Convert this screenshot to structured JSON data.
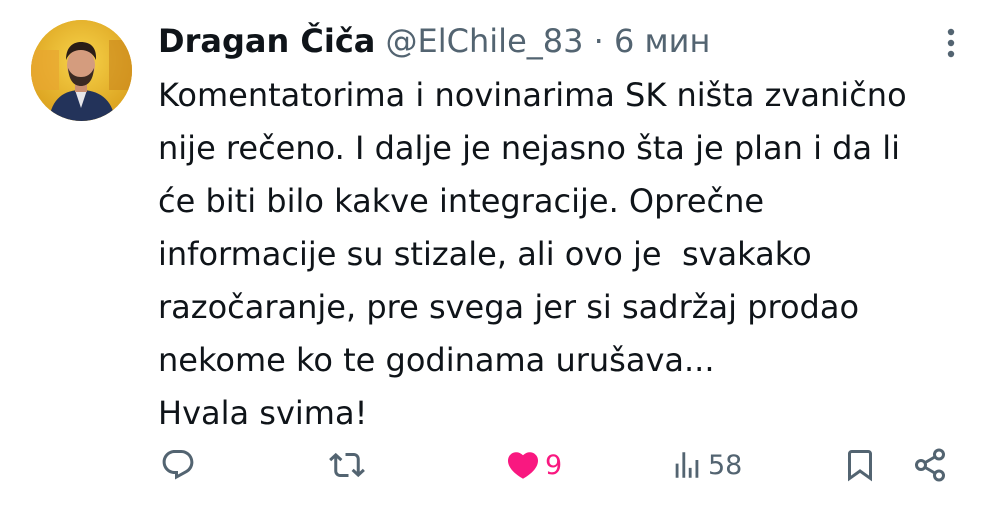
{
  "tweet": {
    "display_name": "Dragan Čiča",
    "handle": "@ElChile_83",
    "separator": "·",
    "time": "6 мин",
    "text_lines": [
      "Komentatorima i novinarima SK ništa zvanično",
      "nije rečeno. I dalje je nejasno šta je plan i da li",
      "će biti bilo kakve integracije. Oprečne",
      "informacije su stizale, ali ovo je  svakako",
      "razočaranje, pre svega jer si sadržaj prodao",
      "nekome ko te godinama urušava...",
      "Hvala svima!"
    ],
    "actions": {
      "reply_icon": "reply-icon",
      "retweet_icon": "retweet-icon",
      "like_icon": "heart-filled-icon",
      "like_count": "9",
      "views_icon": "views-icon",
      "views_count": "58",
      "bookmark_icon": "bookmark-icon",
      "share_icon": "share-icon"
    }
  },
  "colors": {
    "text": "#0f1419",
    "secondary": "#536471",
    "like": "#f91880",
    "avatar_background": "#e9b62a"
  }
}
